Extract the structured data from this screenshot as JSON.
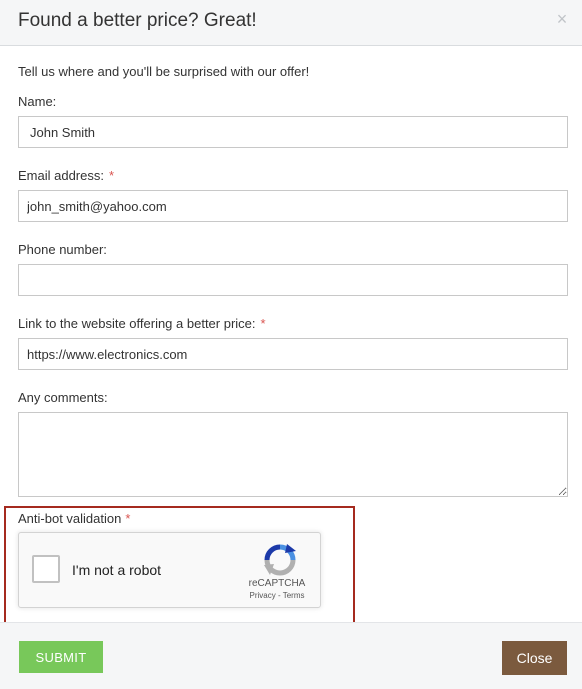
{
  "dialog": {
    "title": "Found a better price? Great!",
    "close_glyph": "×",
    "intro": "Tell us where and you'll be surprised with our offer!"
  },
  "form": {
    "name": {
      "label": "Name:",
      "value": "John Smith",
      "required": false
    },
    "email": {
      "label": "Email address:",
      "value": "john_smith@yahoo.com",
      "required": true
    },
    "phone": {
      "label": "Phone number:",
      "value": "",
      "required": false
    },
    "link": {
      "label": "Link to the website offering a better price:",
      "value": "https://www.electronics.com",
      "required": true
    },
    "comments": {
      "label": "Any comments:",
      "value": "",
      "required": false
    },
    "required_marker": "*"
  },
  "captcha": {
    "label": "Anti-bot validation",
    "checkbox_text": "I'm not a robot",
    "brand": "reCAPTCHA",
    "links": "Privacy - Terms",
    "checked": false
  },
  "footer": {
    "submit_label": "SUBMIT",
    "close_label": "Close"
  },
  "colors": {
    "submit": "#78c85a",
    "close": "#7b5a3e",
    "required": "#d9534f",
    "highlight": "#a52a1f"
  }
}
